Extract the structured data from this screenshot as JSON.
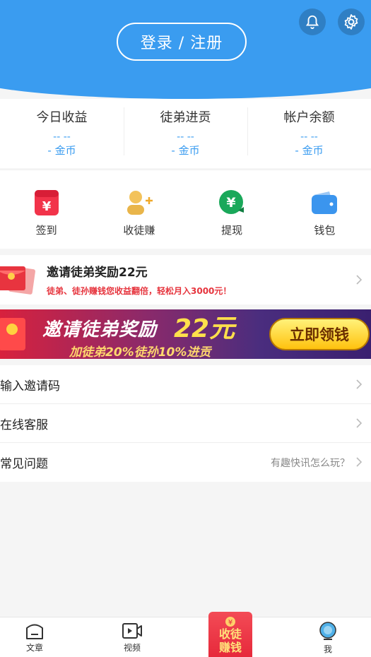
{
  "header": {
    "login_label": "登录 / 注册"
  },
  "stats": [
    {
      "title": "今日收益",
      "dash": "-- --",
      "coin": "- 金币"
    },
    {
      "title": "徒弟进贡",
      "dash": "-- --",
      "coin": "- 金币"
    },
    {
      "title": "帐户余额",
      "dash": "-- --",
      "coin": "- 金币"
    }
  ],
  "quick": [
    {
      "label": "签到",
      "icon": "signin-icon"
    },
    {
      "label": "收徒赚",
      "icon": "recruit-icon"
    },
    {
      "label": "提现",
      "icon": "withdraw-icon"
    },
    {
      "label": "钱包",
      "icon": "wallet-icon"
    }
  ],
  "invite": {
    "title": "邀请徒弟奖励22元",
    "subtitle": "徒弟、徒孙赚钱您收益翻倍，轻松月入3000元！"
  },
  "banner": {
    "title": "邀请徒弟奖励",
    "amount": "22元",
    "subtitle": "加徒弟20%徒孙10%进贡",
    "button": "立即领钱"
  },
  "menu": [
    {
      "label": "输入邀请码",
      "right": ""
    },
    {
      "label": "在线客服",
      "right": ""
    },
    {
      "label": "常见问题",
      "right": "有趣快讯怎么玩？"
    }
  ],
  "tabbar": {
    "articles": "文章",
    "video": "视频",
    "center_line1": "收徒",
    "center_line2": "赚钱",
    "me": "我"
  },
  "colors": {
    "primary": "#3a9cf0",
    "accent_red": "#e6343d"
  }
}
